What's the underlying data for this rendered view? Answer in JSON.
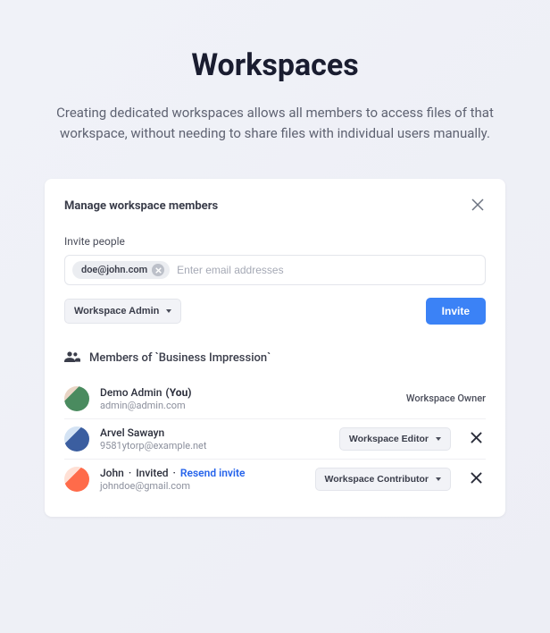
{
  "page": {
    "title": "Workspaces",
    "description": "Creating dedicated workspaces allows all members to access files of that workspace, without needing to share files with individual users manually."
  },
  "modal": {
    "title": "Manage workspace members",
    "invite_label": "Invite people",
    "input_placeholder": "Enter email addresses",
    "chip_email": "doe@john.com",
    "role_dropdown_label": "Workspace Admin",
    "invite_button": "Invite",
    "members_heading": "Members of `Business Impression`"
  },
  "members": [
    {
      "name": "Demo Admin",
      "suffix": "(You)",
      "email": "admin@admin.com",
      "role": "Workspace Owner",
      "is_owner": true
    },
    {
      "name": "Arvel Sawayn",
      "email": "9581ytorp@example.net",
      "role": "Workspace Editor",
      "is_owner": false
    },
    {
      "name": "John",
      "invited_label": "Invited",
      "resend_label": "Resend invite",
      "email": "johndoe@gmail.com",
      "role": "Workspace Contributor",
      "is_owner": false,
      "invited": true
    }
  ]
}
